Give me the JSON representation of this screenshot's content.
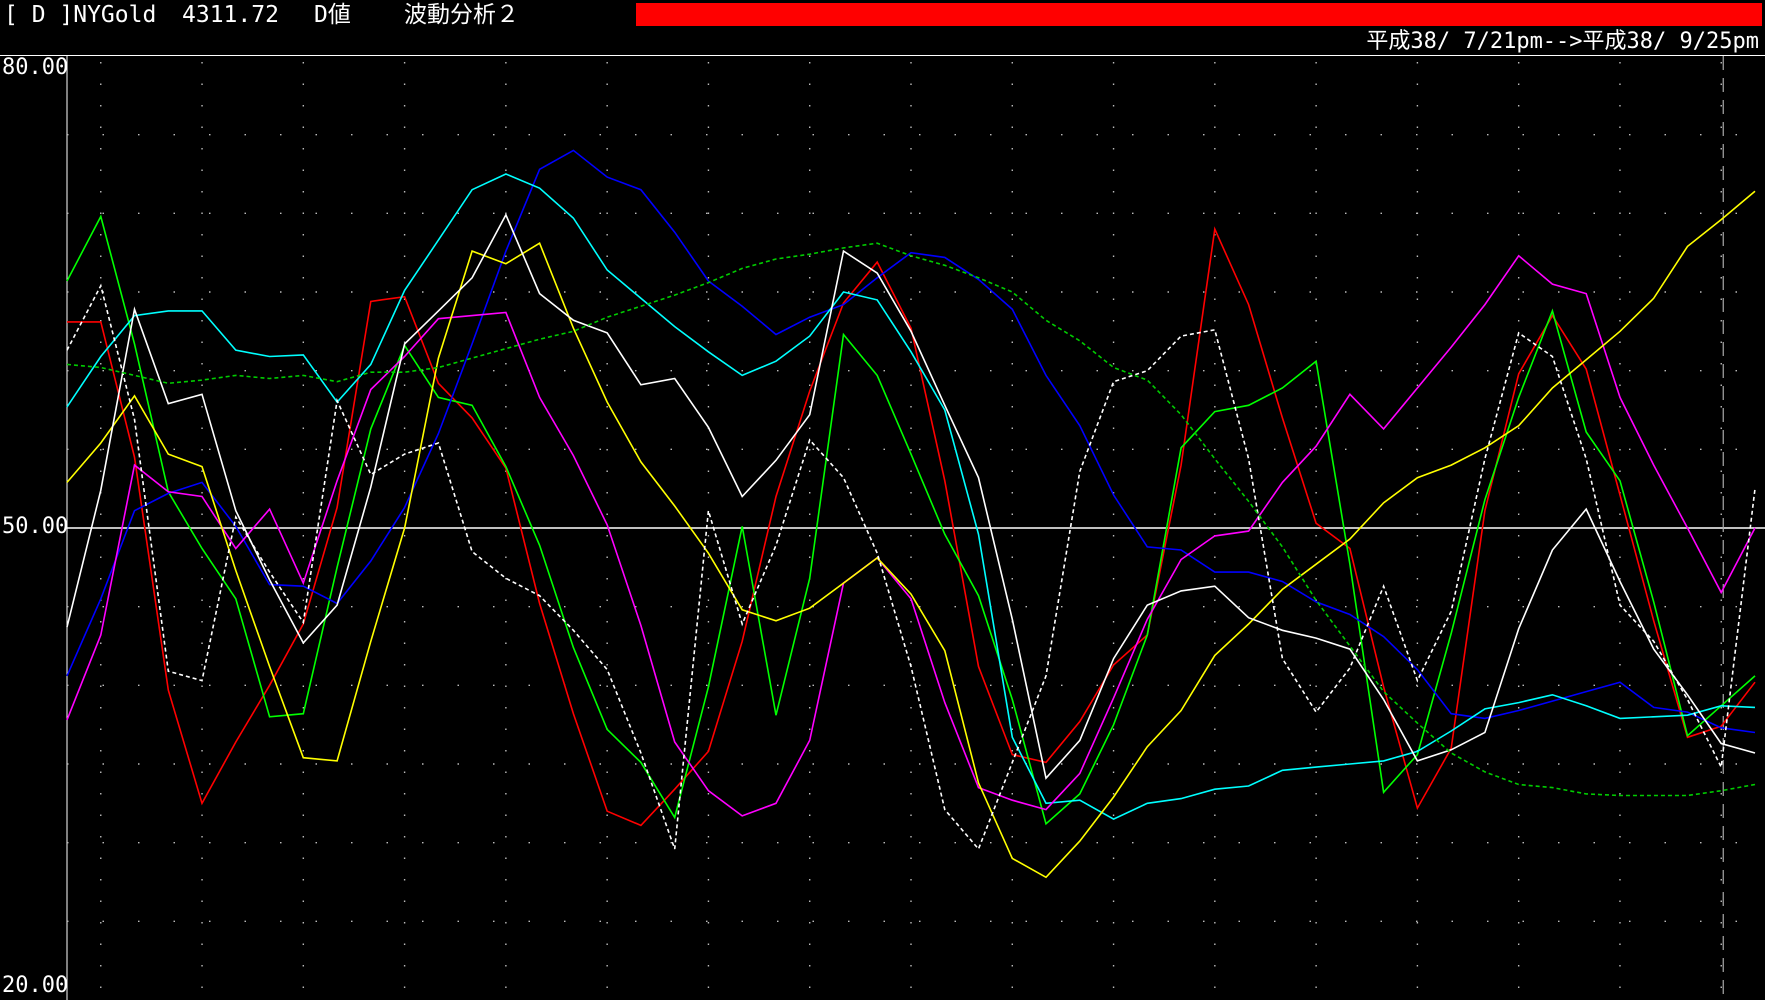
{
  "header": {
    "code": "[ D ]NYGold",
    "price": "4311.72",
    "value_type": "D値",
    "study": "波動分析２",
    "date_range": "平成38/ 7/21pm-->平成38/ 9/25pm",
    "alert_bar_color": "#ff0000"
  },
  "chart_data": {
    "type": "line",
    "y_tick_labels": [
      "80.00",
      "50.00",
      "20.00"
    ],
    "ylim": [
      20,
      80
    ],
    "reference_line": 50,
    "grid": "dotted",
    "x": [
      0,
      1,
      2,
      3,
      4,
      5,
      6,
      7,
      8,
      9,
      10,
      11,
      12,
      13,
      14,
      15,
      16,
      17,
      18,
      19,
      20,
      21,
      22,
      23,
      24,
      25,
      26,
      27,
      28,
      29,
      30,
      31,
      32,
      33,
      34,
      35,
      36,
      37,
      38,
      39,
      40,
      41,
      42,
      43,
      44,
      45,
      46,
      47,
      48,
      49,
      50
    ],
    "series": [
      {
        "color": "#ff0000",
        "style": "solid",
        "values": [
          63.1,
          63.1,
          54.5,
          39.7,
          32.5,
          36.4,
          40.0,
          43.9,
          51.3,
          64.4,
          64.7,
          59.2,
          57.0,
          53.8,
          45.2,
          38.2,
          32.0,
          31.1,
          33.4,
          35.8,
          42.8,
          52.0,
          58.7,
          64.3,
          66.9,
          62.7,
          53.0,
          41.2,
          35.6,
          35.1,
          37.7,
          41.3,
          43.2,
          54.0,
          69.0,
          64.2,
          57.0,
          50.3,
          48.7,
          39.9,
          32.2,
          36.0,
          51.1,
          59.8,
          63.5,
          60.1,
          52.1,
          44.1,
          36.7,
          37.4,
          40.2
        ]
      },
      {
        "color": "#00ff00",
        "style": "solid",
        "values": [
          65.7,
          69.8,
          61.7,
          52.3,
          48.7,
          45.5,
          38.0,
          38.2,
          47.5,
          56.3,
          61.6,
          58.3,
          57.8,
          53.9,
          48.9,
          42.4,
          37.2,
          35.1,
          31.6,
          39.9,
          50.1,
          38.1,
          46.8,
          62.3,
          59.7,
          54.7,
          49.6,
          45.7,
          39.1,
          31.2,
          33.1,
          37.5,
          43.2,
          55.1,
          57.4,
          57.8,
          58.9,
          60.6,
          47.7,
          33.2,
          35.6,
          43.3,
          51.8,
          58.3,
          63.8,
          56.1,
          53.0,
          45.3,
          36.8,
          38.7,
          40.6
        ]
      },
      {
        "color": "#0000ff",
        "style": "solid",
        "values": [
          40.6,
          45.5,
          51.1,
          52.2,
          52.9,
          50.1,
          46.4,
          46.3,
          45.2,
          47.9,
          51.3,
          56.0,
          61.7,
          67.6,
          72.8,
          74.0,
          72.3,
          71.5,
          68.8,
          65.7,
          64.1,
          62.3,
          63.4,
          64.2,
          65.9,
          67.5,
          67.2,
          65.8,
          63.9,
          59.7,
          56.5,
          52.1,
          48.8,
          48.6,
          47.2,
          47.2,
          46.6,
          45.3,
          44.5,
          43.1,
          41.0,
          38.2,
          37.9,
          38.4,
          39.0,
          39.6,
          40.2,
          38.6,
          38.3,
          37.3,
          37.0
        ]
      },
      {
        "color": "#00ffff",
        "style": "solid",
        "values": [
          57.7,
          60.9,
          63.5,
          63.8,
          63.8,
          61.3,
          60.9,
          61.0,
          58.0,
          60.4,
          65.1,
          68.3,
          71.5,
          72.5,
          71.6,
          69.7,
          66.4,
          64.6,
          62.8,
          61.2,
          59.7,
          60.6,
          62.2,
          65.0,
          64.5,
          61.2,
          57.5,
          49.6,
          36.7,
          32.5,
          32.7,
          31.5,
          32.5,
          32.8,
          33.4,
          33.6,
          34.6,
          34.8,
          35.0,
          35.2,
          35.8,
          37.1,
          38.5,
          38.9,
          39.4,
          38.7,
          37.9,
          38.0,
          38.1,
          38.7,
          38.6
        ]
      },
      {
        "color": "#ff00ff",
        "style": "solid",
        "values": [
          37.8,
          43.2,
          54.0,
          52.3,
          52.0,
          48.7,
          51.2,
          46.5,
          53.0,
          58.8,
          60.9,
          63.3,
          63.5,
          63.7,
          58.3,
          54.6,
          50.2,
          43.8,
          36.4,
          33.3,
          31.7,
          32.5,
          36.5,
          46.5,
          48.1,
          45.5,
          38.9,
          33.5,
          32.7,
          32.1,
          34.4,
          39.2,
          44.2,
          48.0,
          49.5,
          49.8,
          52.9,
          55.2,
          58.5,
          56.3,
          58.9,
          61.5,
          64.2,
          67.3,
          65.5,
          64.9,
          58.3,
          54.0,
          50.0,
          45.9,
          50.0
        ]
      },
      {
        "color": "#ffff00",
        "style": "solid",
        "values": [
          52.9,
          55.4,
          58.4,
          54.7,
          53.9,
          47.3,
          41.2,
          35.4,
          35.2,
          42.8,
          50.0,
          60.8,
          67.6,
          66.8,
          68.1,
          62.7,
          58.0,
          54.2,
          51.4,
          48.4,
          44.8,
          44.1,
          44.9,
          46.5,
          48.1,
          45.8,
          42.2,
          33.8,
          29.0,
          27.8,
          30.1,
          32.9,
          36.1,
          38.4,
          41.9,
          43.9,
          46.1,
          47.7,
          49.3,
          51.6,
          53.2,
          54.0,
          55.1,
          56.5,
          58.9,
          60.7,
          62.5,
          64.6,
          67.9,
          69.6,
          71.4
        ]
      },
      {
        "color": "#ffffff",
        "style": "solid",
        "values": [
          43.7,
          52.4,
          63.9,
          57.9,
          58.5,
          51.1,
          46.7,
          42.7,
          45.1,
          52.6,
          61.7,
          63.8,
          65.9,
          69.9,
          64.9,
          63.2,
          62.4,
          59.1,
          59.5,
          56.4,
          52.0,
          54.3,
          57.2,
          67.6,
          66.2,
          62.5,
          57.8,
          53.2,
          44.2,
          34.1,
          36.5,
          41.7,
          45.1,
          46.0,
          46.3,
          44.3,
          43.5,
          43.0,
          42.3,
          39.1,
          35.2,
          35.9,
          37.0,
          43.6,
          48.6,
          51.2,
          46.6,
          42.3,
          39.4,
          36.3,
          35.7
        ]
      },
      {
        "color": "#ffffff",
        "style": "dotted",
        "values": [
          61.3,
          65.4,
          56.9,
          40.9,
          40.3,
          50.7,
          47.2,
          44.0,
          58.1,
          53.4,
          54.7,
          55.4,
          48.5,
          46.8,
          45.7,
          43.5,
          41.0,
          35.7,
          29.6,
          51.1,
          43.9,
          48.9,
          55.6,
          53.2,
          48.4,
          41.2,
          32.1,
          29.6,
          35.1,
          40.6,
          53.6,
          59.3,
          60.0,
          62.2,
          62.6,
          54.4,
          41.7,
          38.3,
          41.1,
          46.3,
          40.3,
          44.7,
          54.4,
          62.4,
          60.9,
          54.4,
          45.1,
          42.8,
          39.1,
          34.8,
          52.5
        ]
      },
      {
        "color": "#00cc00",
        "style": "dotted",
        "values": [
          60.4,
          60.2,
          59.7,
          59.2,
          59.4,
          59.7,
          59.5,
          59.7,
          59.3,
          59.9,
          59.9,
          60.2,
          60.8,
          61.4,
          62.0,
          62.5,
          63.4,
          64.1,
          64.8,
          65.6,
          66.5,
          67.1,
          67.4,
          67.8,
          68.1,
          67.3,
          66.7,
          65.9,
          65.0,
          63.2,
          61.9,
          60.2,
          59.4,
          57.2,
          54.4,
          51.7,
          48.8,
          45.4,
          42.5,
          39.6,
          37.6,
          35.7,
          34.5,
          33.7,
          33.5,
          33.1,
          33.0,
          33.0,
          33.0,
          33.3,
          33.7
        ]
      }
    ]
  }
}
